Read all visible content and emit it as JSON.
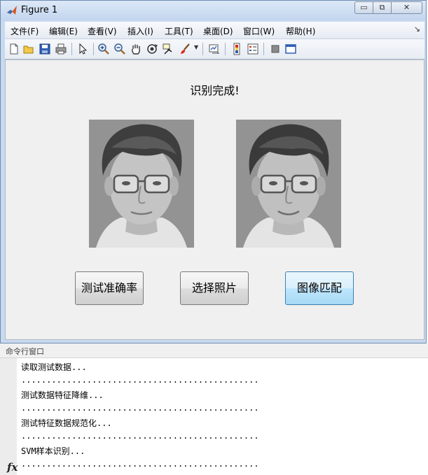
{
  "window": {
    "title": "Figure 1",
    "controls": {
      "minimize": "▭",
      "maximize": "⧉",
      "close": "✕"
    }
  },
  "menu": {
    "items": [
      "文件(F)",
      "编辑(E)",
      "查看(V)",
      "插入(I)",
      "工具(T)",
      "桌面(D)",
      "窗口(W)",
      "帮助(H)"
    ],
    "overflow_arrow": "↘"
  },
  "toolbar": {
    "icons": [
      "new-file-icon",
      "open-folder-icon",
      "save-icon",
      "print-icon",
      "pointer-icon",
      "zoom-in-icon",
      "zoom-out-icon",
      "pan-hand-icon",
      "rotate-3d-icon",
      "data-cursor-icon",
      "brush-icon",
      "link-plot-icon",
      "colorbar-icon",
      "legend-icon",
      "hide-plot-tools-icon",
      "show-plot-tools-icon"
    ]
  },
  "figure": {
    "status_text": "识别完成!",
    "images": [
      "face-query",
      "face-match"
    ]
  },
  "buttons": {
    "test_accuracy": "测试准确率",
    "select_photo": "选择照片",
    "image_match": "图像匹配"
  },
  "command_window": {
    "title": "命令行窗口",
    "prompt_symbol": "fx",
    "lines": [
      "读取测试数据...",
      "...............................................",
      "测试数据特征降维...",
      "...............................................",
      "测试特征数据规范化...",
      "...............................................",
      "SVM样本识别...",
      "..............................................."
    ]
  },
  "colors": {
    "titlebar": "#c9d9ee",
    "canvas": "#f0f0f0",
    "button_focus": "#bee6fd"
  }
}
